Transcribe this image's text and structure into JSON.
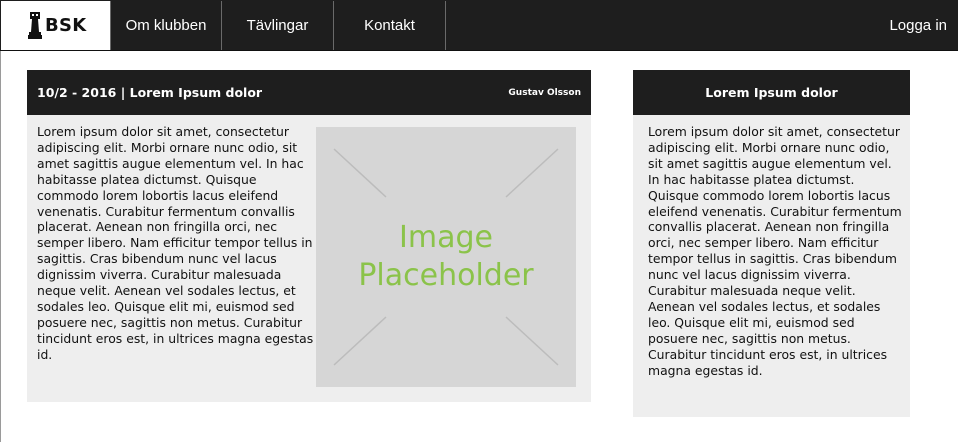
{
  "navbar": {
    "brand": "BSK",
    "brand_icon": "chess-rook-icon",
    "items": [
      {
        "label": "Om klubben"
      },
      {
        "label": "Tävlingar"
      },
      {
        "label": "Kontakt"
      }
    ],
    "login_label": "Logga in",
    "background": "#1e1e1e"
  },
  "article": {
    "title": "10/2 - 2016 | Lorem Ipsum dolor",
    "author": "Gustav Olsson",
    "body": "Lorem ipsum dolor sit amet, consectetur adipiscing elit. Morbi ornare nunc odio, sit amet sagittis augue elementum vel. In hac habitasse platea dictumst. Quisque commodo lorem lobortis lacus eleifend venenatis. Curabitur fermentum convallis placerat. Aenean non fringilla orci, nec semper libero. Nam efficitur tempor tellus in sagittis. Cras bibendum nunc vel lacus dignissim viverra. Curabitur malesuada neque velit. Aenean vel sodales lectus, et sodales leo. Quisque elit mi, euismod sed posuere nec, sagittis non metus. Curabitur tincidunt eros est, in ultrices magna egestas id.",
    "image": {
      "line1": "Image",
      "line2": "Placeholder",
      "text_color": "#8bc34a"
    }
  },
  "sidebar": {
    "title": "Lorem Ipsum dolor",
    "body": "Lorem ipsum dolor sit amet, consectetur adipiscing elit. Morbi ornare nunc odio, sit amet sagittis augue elementum vel. In hac habitasse platea dictumst. Quisque commodo lorem lobortis lacus eleifend venenatis. Curabitur fermentum convallis placerat. Aenean non fringilla orci, nec semper libero. Nam efficitur tempor tellus in sagittis. Cras bibendum nunc vel lacus dignissim viverra. Curabitur malesuada neque velit. Aenean vel sodales lectus, et sodales leo. Quisque elit mi, euismod sed posuere nec, sagittis non metus. Curabitur tincidunt eros est, in ultrices magna egestas id."
  }
}
